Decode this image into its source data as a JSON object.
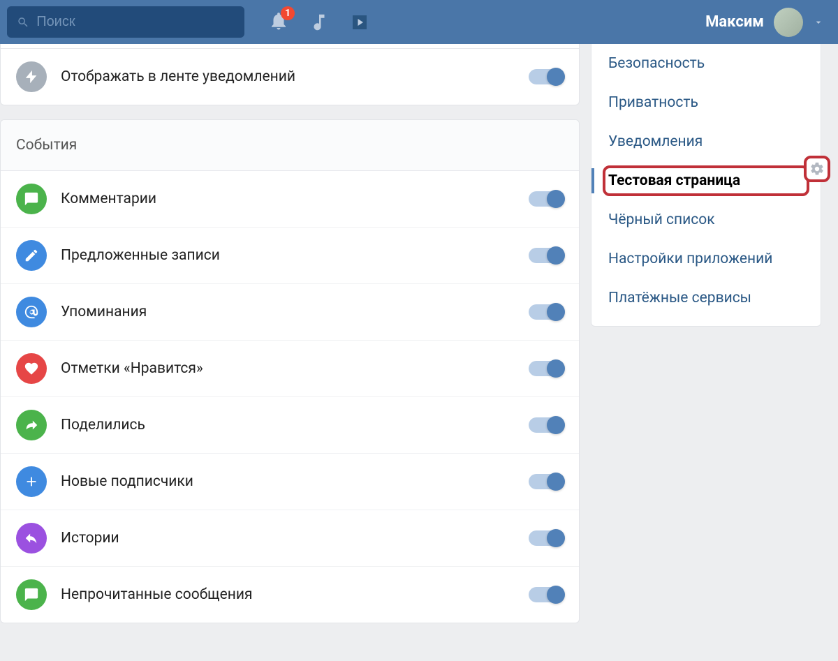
{
  "header": {
    "search_placeholder": "Поиск",
    "badge_count": "1",
    "user_name": "Максим"
  },
  "feed_row": {
    "label": "Отображать в ленте уведомлений"
  },
  "events": {
    "title": "События",
    "items": [
      {
        "icon": "comment",
        "color": "ic-green",
        "label": "Комментарии"
      },
      {
        "icon": "pencil",
        "color": "ic-blue",
        "label": "Предложенные записи"
      },
      {
        "icon": "at",
        "color": "ic-blue",
        "label": "Упоминания"
      },
      {
        "icon": "heart",
        "color": "ic-red",
        "label": "Отметки «Нравится»"
      },
      {
        "icon": "share",
        "color": "ic-green",
        "label": "Поделились"
      },
      {
        "icon": "plus",
        "color": "ic-plus",
        "label": "Новые подписчики"
      },
      {
        "icon": "reply",
        "color": "ic-purple",
        "label": "Истории"
      },
      {
        "icon": "comment",
        "color": "ic-green",
        "label": "Непрочитанные сообщения"
      }
    ]
  },
  "sidebar": {
    "items": [
      {
        "label": "Безопасность"
      },
      {
        "label": "Приватность"
      },
      {
        "label": "Уведомления"
      },
      {
        "label": "Тестовая страница"
      },
      {
        "label": "Чёрный список"
      },
      {
        "label": "Настройки приложений"
      },
      {
        "label": "Платёжные сервисы"
      }
    ],
    "active_index": 3
  }
}
